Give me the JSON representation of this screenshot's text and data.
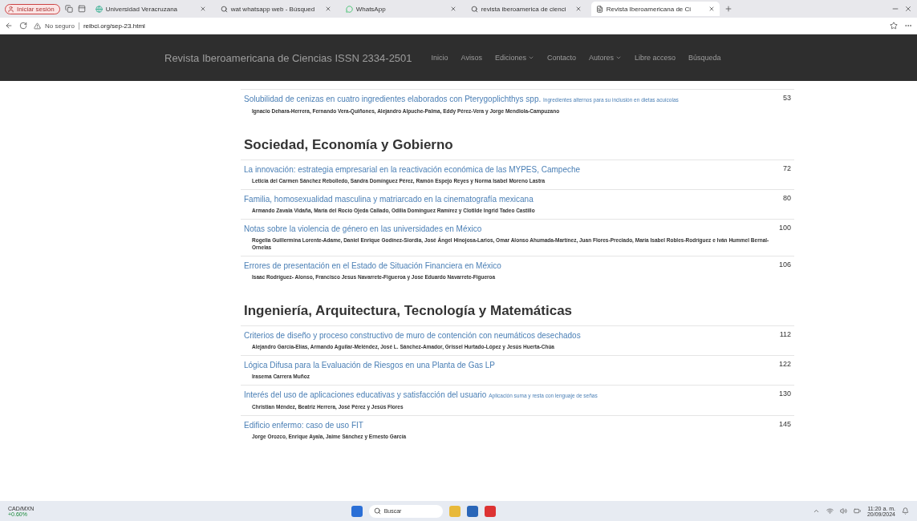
{
  "browser": {
    "profile": "Iniciar sesión",
    "tabs": [
      {
        "title": "Universidad Veracruzana",
        "kind": "site",
        "selected": false
      },
      {
        "title": "wat whatsapp web - Búsqued",
        "kind": "search",
        "selected": false
      },
      {
        "title": "WhatsApp",
        "kind": "chat",
        "selected": false
      },
      {
        "title": "revista iberoamerica de cienci",
        "kind": "search",
        "selected": false
      },
      {
        "title": "Revista Iberoamericana de Ci",
        "kind": "page",
        "selected": true
      }
    ],
    "security": "No seguro",
    "url": "reibci.org/sep-23.html"
  },
  "navbar": {
    "brand": "Revista Iberoamericana de Ciencias ISSN 2334-2501",
    "items": [
      {
        "label": "Inicio",
        "dropdown": false
      },
      {
        "label": "Avisos",
        "dropdown": false
      },
      {
        "label": "Ediciones",
        "dropdown": true
      },
      {
        "label": "Contacto",
        "dropdown": false
      },
      {
        "label": "Autores",
        "dropdown": true
      },
      {
        "label": "Libre acceso",
        "dropdown": false
      },
      {
        "label": "Búsqueda",
        "dropdown": false
      }
    ]
  },
  "sections": [
    {
      "articles": [
        {
          "title": "Solubilidad de cenizas en cuatro ingredientes elaborados con Pterygoplichthys spp.",
          "subtitle": "Ingredientes alternos para su inclusión en dietas acuícolas",
          "authors": "Ignacio Dehara-Herrera, Fernando Vera-Quiñones, Alejandro Alpuche-Palma, Eddy Pérez-Vera y Jorge Mendiola-Campuzano",
          "page": "53"
        }
      ]
    },
    {
      "heading": "Sociedad, Economía y Gobierno",
      "articles": [
        {
          "title": "La innovación: estrategia empresarial en la reactivación económica de las MYPES, Campeche",
          "authors": "Leticia del Carmen Sánchez Rebolledo, Sandra Domínguez Pérez, Ramón Espejo Reyes y Norma Isabel Moreno Lastra",
          "page": "72"
        },
        {
          "title": "Familia, homosexualidad masculina y matriarcado en la cinematografía mexicana",
          "authors": "Armando Zavala Vidaña, María del Rocío Ojeda Callado, Odilia Domínguez Ramírez y Clotilde Ingrid Tadeo Castillo",
          "page": "80"
        },
        {
          "title": "Notas sobre la violencia de género en las universidades en México",
          "authors": "Rogelia Guillermina Lorente-Adame, Daniel Enrique Godínez-Siordia, José Ángel Hinojosa-Larios, Omar Alonso Ahumada-Martínez, Juan Flores-Preciado, María Isabel Robles-Rodríguez e Iván Hummel Bernal-Ornelas",
          "page": "100"
        },
        {
          "title": "Errores de presentación en el Estado de Situación Financiera en México",
          "authors": "Isaac Rodríguez- Alonso, Francisco Jesus Navarrete-Figueroa y Jose Eduardo Navarrete-Figueroa",
          "page": "106"
        }
      ]
    },
    {
      "heading": "Ingeniería, Arquitectura, Tecnología y Matemáticas",
      "articles": [
        {
          "title": "Criterios de diseño y proceso constructivo de muro de contención con neumáticos desechados",
          "authors": "Alejandro García-Elías, Armando Aguilar-Meléndez, José L. Sánchez-Amador, Grissel Hurtado-López y Jesús Huerta-Chúa",
          "page": "112"
        },
        {
          "title": "Lógica Difusa para la Evaluación de Riesgos en una Planta de Gas LP",
          "authors": "Irasema Carrera Muñoz",
          "page": "122"
        },
        {
          "title": "Interés del uso de aplicaciones educativas y satisfacción del usuario",
          "subtitle": "Aplicación suma y resta con lenguaje de señas",
          "authors": "Christian Méndez, Beatriz Herrera, José Pérez y Jesús Flores",
          "page": "130"
        },
        {
          "title": "Edificio enfermo: caso de uso FIT",
          "authors": "Jorge Orozco, Enrique Ayala, Jaime Sánchez y Ernesto García",
          "page": "145"
        }
      ]
    }
  ],
  "taskbar": {
    "ticker": "CAD/MXN",
    "change": "+0.60%",
    "search": "Buscar",
    "time": "11:20 a. m.",
    "date": "20/09/2024"
  }
}
